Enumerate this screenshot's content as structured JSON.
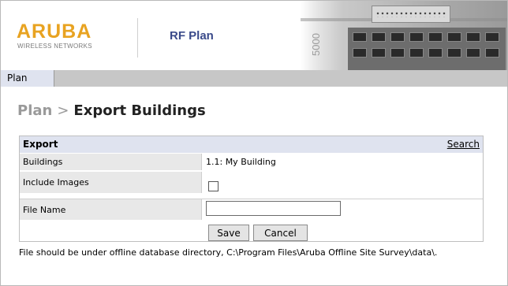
{
  "header": {
    "brand_name": "ARUBA",
    "brand_sub": "WIRELESS NETWORKS",
    "app_title": "RF Plan",
    "device_model": "5000"
  },
  "nav": {
    "tabs": [
      {
        "label": "Plan"
      }
    ]
  },
  "breadcrumb": {
    "parent": "Plan",
    "separator": ">",
    "current": "Export Buildings"
  },
  "export_panel": {
    "title": "Export",
    "search_label": "Search",
    "rows": {
      "buildings": {
        "label": "Buildings",
        "value": "1.1: My Building"
      },
      "include_images": {
        "label": "Include Images",
        "checked": false
      },
      "file_name": {
        "label": "File Name",
        "value": ""
      }
    },
    "save_label": "Save",
    "cancel_label": "Cancel"
  },
  "note": "File should be under offline database directory, C:\\Program Files\\Aruba Offline Site Survey\\data\\.",
  "colors": {
    "brand": "#e8a321",
    "app_title": "#3a4a8a",
    "panel_header": "#dfe3ef",
    "tabbar": "#c7c7c7"
  }
}
